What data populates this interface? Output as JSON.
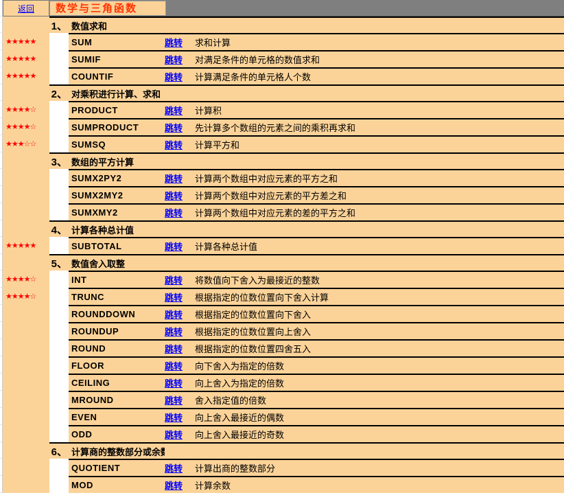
{
  "header": {
    "back": "返回",
    "title": "数学与三角函数"
  },
  "jump_label": "跳转",
  "stars5": "★★★★★",
  "stars4o": "★★★★☆",
  "stars3o": "★★★☆☆",
  "sections": [
    {
      "num": "1、",
      "label": "数值求和",
      "rows": [
        {
          "stars": "stars5",
          "fn": "SUM",
          "desc": "求和计算"
        },
        {
          "stars": "stars5",
          "fn": "SUMIF",
          "desc": "对满足条件的单元格的数值求和"
        },
        {
          "stars": "stars5",
          "fn": "COUNTIF",
          "desc": "计算满足条件的单元格人个数"
        }
      ]
    },
    {
      "num": "2、",
      "label": "对乘积进行计算、求和",
      "rows": [
        {
          "stars": "stars4o",
          "fn": "PRODUCT",
          "desc": "计算积"
        },
        {
          "stars": "stars4o",
          "fn": "SUMPRODUCT",
          "desc": "先计算多个数组的元素之间的乘积再求和"
        },
        {
          "stars": "stars3o",
          "fn": "SUMSQ",
          "desc": "计算平方和"
        }
      ]
    },
    {
      "num": "3、",
      "label": "数组的平方计算",
      "rows": [
        {
          "stars": "",
          "fn": "SUMX2PY2",
          "desc": "计算两个数组中对应元素的平方之和"
        },
        {
          "stars": "",
          "fn": "SUMX2MY2",
          "desc": "计算两个数组中对应元素的平方差之和"
        },
        {
          "stars": "",
          "fn": "SUMXMY2",
          "desc": "计算两个数组中对应元素的差的平方之和"
        }
      ]
    },
    {
      "num": "4、",
      "label": "计算各种总计值",
      "rows": [
        {
          "stars": "stars5",
          "fn": "SUBTOTAL",
          "desc": "计算各种总计值"
        }
      ]
    },
    {
      "num": "5、",
      "label": "数值舍入取整",
      "rows": [
        {
          "stars": "stars4o",
          "fn": "INT",
          "desc": "将数值向下舍入为最接近的整数"
        },
        {
          "stars": "stars4o",
          "fn": "TRUNC",
          "desc": "根据指定的位数位置向下舍入计算"
        },
        {
          "stars": "",
          "fn": "ROUNDDOWN",
          "desc": "根据指定的位数位置向下舍入"
        },
        {
          "stars": "",
          "fn": "ROUNDUP",
          "desc": "根据指定的位数位置向上舍入"
        },
        {
          "stars": "",
          "fn": "ROUND",
          "desc": "根据指定的位数位置四舍五入"
        },
        {
          "stars": "",
          "fn": "FLOOR",
          "desc": "向下舍入为指定的倍数"
        },
        {
          "stars": "",
          "fn": "CEILING",
          "desc": "向上舍入为指定的倍数"
        },
        {
          "stars": "",
          "fn": "MROUND",
          "desc": "舍入指定值的倍数"
        },
        {
          "stars": "",
          "fn": "EVEN",
          "desc": "向上舍入最接近的偶数"
        },
        {
          "stars": "",
          "fn": "ODD",
          "desc": "向上舍入最接近的奇数"
        }
      ]
    },
    {
      "num": "6、",
      "label": "计算商的整数部分或余数",
      "rows": [
        {
          "stars": "",
          "fn": "QUOTIENT",
          "desc": "计算出商的整数部分"
        },
        {
          "stars": "",
          "fn": "MOD",
          "desc": "计算余数"
        }
      ]
    }
  ]
}
